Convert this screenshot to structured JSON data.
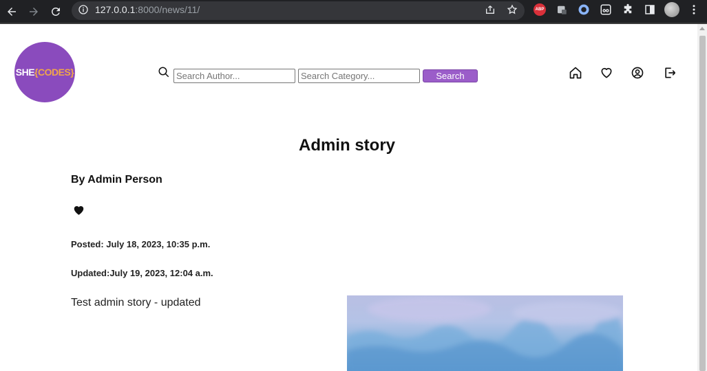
{
  "browser": {
    "url_host": "127.0.0.1",
    "url_path": ":8000/news/11/",
    "extension_abp_label": "ABP"
  },
  "site": {
    "logo_she": "SHE",
    "logo_codes": "{CODES}",
    "search_author_placeholder": "Search Author...",
    "search_category_placeholder": "Search Category...",
    "search_button_label": "Search",
    "nav_icons": [
      "home-icon",
      "heart-outline-icon",
      "user-circle-icon",
      "logout-icon"
    ]
  },
  "article": {
    "title": "Admin story",
    "author": "By Admin Person",
    "posted": "Posted: July 18, 2023, 10:35 p.m.",
    "updated": "Updated:July 19, 2023, 12:04 a.m.",
    "body": "Test admin story - updated"
  },
  "colors": {
    "brand_purple": "#8a4bbd",
    "logo_accent": "#f0a64a",
    "button_purple": "#9b5dc9",
    "chrome_bg": "#202124"
  }
}
